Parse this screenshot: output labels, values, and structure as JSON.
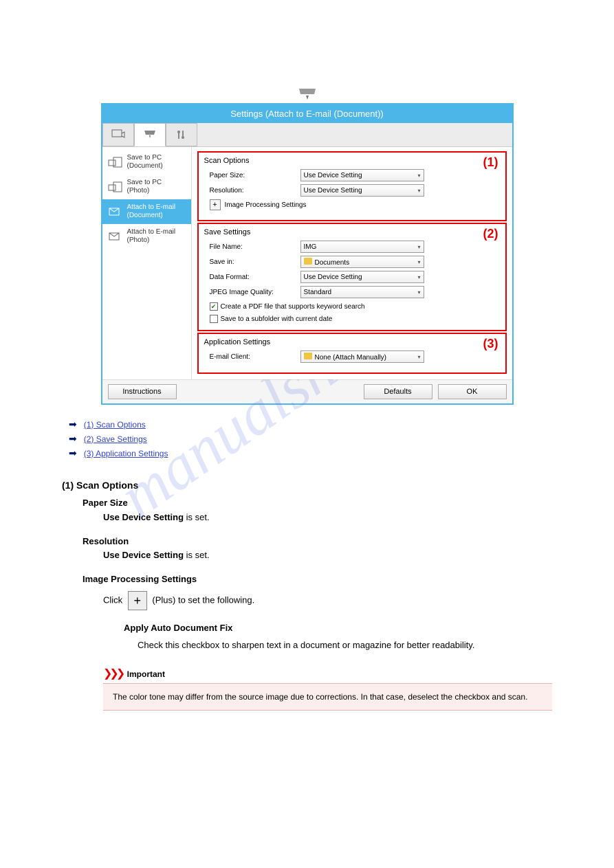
{
  "watermark": "manualshive.com",
  "dialog": {
    "title": "Settings (Attach to E-mail (Document))",
    "sidebar": [
      {
        "line1": "Save to PC",
        "line2": "(Document)"
      },
      {
        "line1": "Save to PC",
        "line2": "(Photo)"
      },
      {
        "line1": "Attach to E-mail",
        "line2": "(Document)"
      },
      {
        "line1": "Attach to E-mail",
        "line2": "(Photo)"
      }
    ],
    "sections": {
      "scan": {
        "title": "Scan Options",
        "label": "(1)",
        "paper_size_lbl": "Paper Size:",
        "paper_size_val": "Use Device Setting",
        "resolution_lbl": "Resolution:",
        "resolution_val": "Use Device Setting",
        "img_proc_lbl": "Image Processing Settings"
      },
      "save": {
        "title": "Save Settings",
        "label": "(2)",
        "file_name_lbl": "File Name:",
        "file_name_val": "IMG",
        "save_in_lbl": "Save in:",
        "save_in_val": "Documents",
        "data_format_lbl": "Data Format:",
        "data_format_val": "Use Device Setting",
        "jpeg_lbl": "JPEG Image Quality:",
        "jpeg_val": "Standard",
        "chk1": "Create a PDF file that supports keyword search",
        "chk2": "Save to a subfolder with current date"
      },
      "app": {
        "title": "Application Settings",
        "label": "(3)",
        "email_lbl": "E-mail Client:",
        "email_val": "None (Attach Manually)"
      }
    },
    "footer": {
      "instructions": "Instructions",
      "defaults": "Defaults",
      "ok": "OK"
    }
  },
  "arrow_links": [
    "(1) Scan Options",
    "(2) Save Settings",
    "(3) Application Settings"
  ],
  "section_heading": "(1) Scan Options",
  "paper_size_h": "Paper Size",
  "paper_size_p": "Use Device Setting",
  "paper_size_p2": " is set.",
  "resolution_h": "Resolution",
  "resolution_p": "Use Device Setting",
  "resolution_p2": " is set.",
  "img_proc_h": "Image Processing Settings",
  "img_proc_pre": "Click ",
  "img_proc_post": " (Plus) to set the following.",
  "apply_auto_h": "Apply Auto Document Fix",
  "apply_auto_p": "Check this checkbox to sharpen text in a document or magazine for better readability.",
  "important_h": "Important",
  "important_p": "The color tone may differ from the source image due to corrections. In that case, deselect the checkbox and scan."
}
